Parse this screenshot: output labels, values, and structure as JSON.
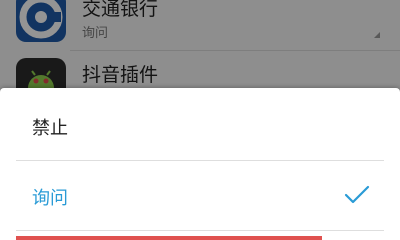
{
  "background_list": {
    "apps": [
      {
        "name": "交通银行",
        "status": "询问",
        "icon": "bank-logo-icon"
      },
      {
        "name": "抖音插件",
        "status": "",
        "icon": "android-app-icon"
      }
    ]
  },
  "dialog": {
    "options": [
      {
        "label": "禁止",
        "selected": false
      },
      {
        "label": "询问",
        "selected": true,
        "indicator": "check-icon"
      }
    ]
  },
  "colors": {
    "accent": "#2a9bd6",
    "bottom_bar": "#e0514f",
    "bank_brand": "#1f5aa8"
  }
}
